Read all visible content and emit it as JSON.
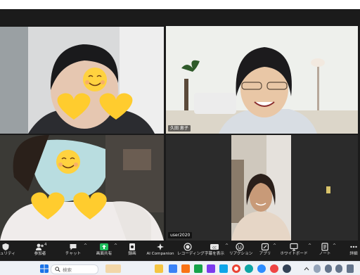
{
  "tiles": [
    {
      "name": "participant-tile-1",
      "label": ""
    },
    {
      "name": "participant-tile-2",
      "label": "久田 恵子",
      "speaking": true
    },
    {
      "name": "participant-tile-3",
      "label": ""
    },
    {
      "name": "participant-tile-4",
      "label": "user2020"
    }
  ],
  "toolbar": {
    "security": "キュリティ",
    "participants": "参加者",
    "participants_count": "4",
    "chat": "チャット",
    "share_screen": "画面共有",
    "record": "録画",
    "ai_companion": "AI Companion",
    "recording": "レコーディング",
    "captions": "字幕を表示",
    "reactions": "リアクション",
    "apps": "アプリ",
    "whiteboard": "ホワイトボード",
    "notes": "ノート",
    "more": "詳細"
  },
  "taskbar": {
    "search_placeholder": "検索"
  },
  "colors": {
    "toolbar_bg": "#1c1c1c",
    "share_screen_green": "#1fbd5c",
    "active_speaker_border": "#c6e06a"
  },
  "icons": [
    "shield-icon",
    "participants-icon",
    "chat-icon",
    "share-screen-icon",
    "record-icon",
    "ai-companion-icon",
    "recording-icon",
    "cc-icon",
    "reaction-icon",
    "apps-icon",
    "whiteboard-icon",
    "notes-icon",
    "more-icon"
  ]
}
